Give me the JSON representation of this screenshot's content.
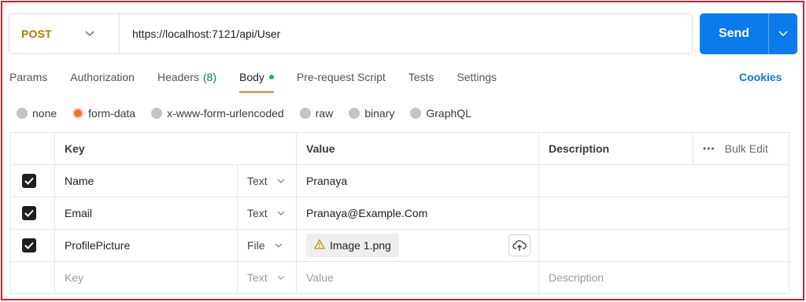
{
  "request": {
    "method": "POST",
    "url": "https://localhost:7121/api/User",
    "send_label": "Send"
  },
  "tabs": [
    {
      "label": "Params"
    },
    {
      "label": "Authorization"
    },
    {
      "label": "Headers",
      "count": "(8)"
    },
    {
      "label": "Body",
      "active": true
    },
    {
      "label": "Pre-request Script"
    },
    {
      "label": "Tests"
    },
    {
      "label": "Settings"
    }
  ],
  "cookies_label": "Cookies",
  "body_modes": [
    {
      "label": "none",
      "selected": false
    },
    {
      "label": "form-data",
      "selected": true
    },
    {
      "label": "x-www-form-urlencoded",
      "selected": false
    },
    {
      "label": "raw",
      "selected": false
    },
    {
      "label": "binary",
      "selected": false
    },
    {
      "label": "GraphQL",
      "selected": false
    }
  ],
  "table": {
    "headers": {
      "key": "Key",
      "value": "Value",
      "description": "Description",
      "more": "•••",
      "bulk_edit": "Bulk Edit"
    },
    "rows": [
      {
        "checked": true,
        "key": "Name",
        "type": "Text",
        "value": "Pranaya",
        "description": ""
      },
      {
        "checked": true,
        "key": "Email",
        "type": "Text",
        "value": "Pranaya@Example.Com",
        "description": ""
      },
      {
        "checked": true,
        "key": "ProfilePicture",
        "type": "File",
        "value": "Image 1.png",
        "description": ""
      }
    ],
    "placeholder": {
      "key": "Key",
      "type": "Text",
      "value": "Value",
      "description": "Description"
    }
  },
  "colors": {
    "accent": "#ff6c37",
    "send": "#097bed",
    "method": "#ad7a03",
    "border": "#d0202c"
  }
}
